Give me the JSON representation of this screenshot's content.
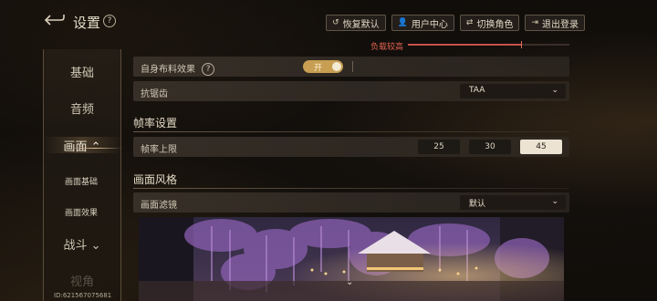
{
  "header": {
    "title": "设置",
    "help_glyph": "?",
    "back_icon": "back-arrow-icon",
    "actions": [
      {
        "icon": "↺",
        "label": "恢复默认"
      },
      {
        "icon": "👤",
        "label": "用户中心"
      },
      {
        "icon": "⇄",
        "label": "切换角色"
      },
      {
        "icon": "⇥",
        "label": "退出登录"
      }
    ]
  },
  "nav": {
    "items": [
      {
        "label": "基础"
      },
      {
        "label": "音频"
      },
      {
        "label": "画面",
        "chevron": "⌃"
      },
      {
        "label": "画面基础"
      },
      {
        "label": "画面效果"
      },
      {
        "label": "战斗",
        "chevron": "⌄"
      },
      {
        "label": "视角"
      }
    ],
    "active": "画面"
  },
  "performance": {
    "label": "负载较高",
    "level": 0.7
  },
  "settings": {
    "cloth_effect": {
      "label": "自身布料效果",
      "help_glyph": "?",
      "toggle_label": "开",
      "on": true
    },
    "anti_aliasing": {
      "label": "抗锯齿",
      "value": "TAA",
      "chevron": "⌄"
    }
  },
  "frame_rate": {
    "section_title": "帧率设置",
    "label": "帧率上限",
    "options": [
      "25",
      "30",
      "45"
    ],
    "selected": "45"
  },
  "style": {
    "section_title": "画面风格",
    "filter_label": "画面滤镜",
    "filter_value": "默认",
    "chevron": "⌄",
    "preview_chevron": "⌄"
  },
  "footer": {
    "id_text": "ID:621567075681"
  },
  "colors": {
    "accent_gold": "#c79e52",
    "warning_red": "#e2624f"
  }
}
